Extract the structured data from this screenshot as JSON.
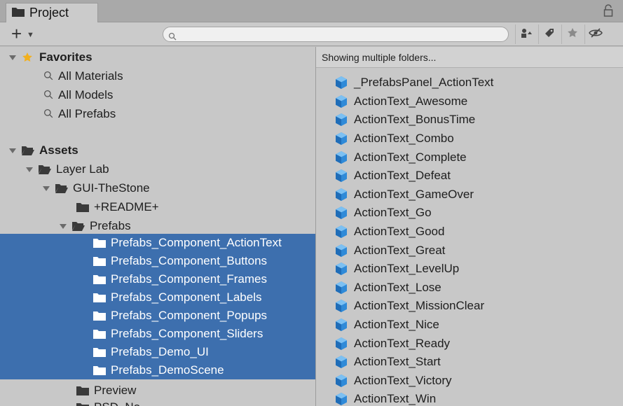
{
  "tab": {
    "label": "Project",
    "icon": "folder-icon"
  },
  "toolbar": {
    "create_label": "+",
    "search_placeholder": "",
    "buttons": [
      "scene-type-icon",
      "tag-icon",
      "star-icon",
      "hidden-packages-icon"
    ]
  },
  "tree": {
    "favorites": {
      "label": "Favorites",
      "items": [
        "All Materials",
        "All Models",
        "All Prefabs"
      ]
    },
    "assets": {
      "label": "Assets",
      "layer_lab": "Layer Lab",
      "gui_thestone": "GUI-TheStone",
      "readme": "+README+",
      "prefabs": "Prefabs",
      "selected_folders": [
        "Prefabs_Component_ActionText",
        "Prefabs_Component_Buttons",
        "Prefabs_Component_Frames",
        "Prefabs_Component_Labels",
        "Prefabs_Component_Popups",
        "Prefabs_Component_Sliders",
        "Prefabs_Demo_UI",
        "Prefabs_DemoScene"
      ],
      "preview": "Preview",
      "partial_next": "PSD_No"
    }
  },
  "content": {
    "header": "Showing multiple folders...",
    "assets": [
      "_PrefabsPanel_ActionText",
      "ActionText_Awesome",
      "ActionText_BonusTime",
      "ActionText_Combo",
      "ActionText_Complete",
      "ActionText_Defeat",
      "ActionText_GameOver",
      "ActionText_Go",
      "ActionText_Good",
      "ActionText_Great",
      "ActionText_LevelUp",
      "ActionText_Lose",
      "ActionText_MissionClear",
      "ActionText_Nice",
      "ActionText_Ready",
      "ActionText_Start",
      "ActionText_Victory",
      "ActionText_Win"
    ]
  },
  "colors": {
    "selection": "#3d6fae",
    "panel": "#c8c8c8",
    "cube": "#2f8ad8",
    "star": "#f2b01e"
  }
}
